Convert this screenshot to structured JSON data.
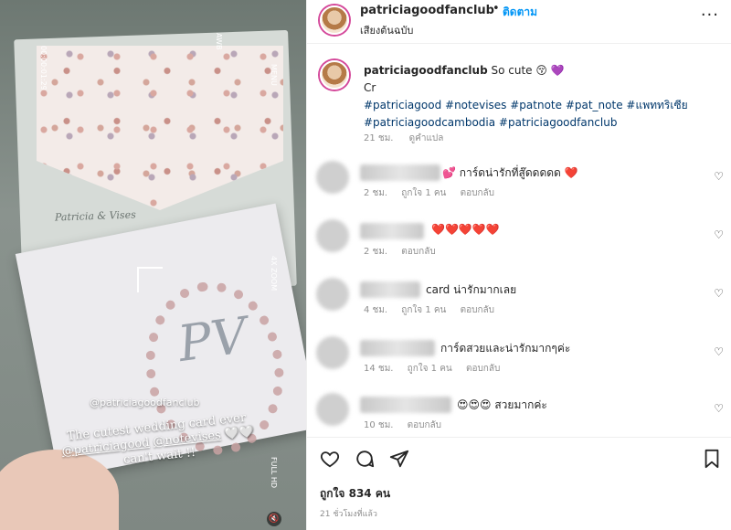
{
  "post": {
    "username": "patriciagoodfanclub",
    "follow_label": "ติดตาม",
    "audio_label": "เสียงต้นฉบับ",
    "more_label": "···"
  },
  "media": {
    "overlay_handle": "@patriciagoodfanclub",
    "overlay_line1": "The cutest wedding card ever",
    "overlay_line2a": "@patriciagood",
    "overlay_line2b": "@notevises",
    "overlay_line3": "can't wait !!",
    "card_script": "Patricia & Vises",
    "monogram": "PV",
    "timecode": "00:00:01:29",
    "awb_label": "AWB",
    "menu_label": "MENU",
    "zoom_label": "4X ZOOM",
    "full_label": "FULL HD"
  },
  "caption": {
    "username": "patriciagoodfanclub",
    "text": "So cute 😚 💜",
    "line2": "Cr",
    "tags_line1": "#patriciagood #notevises #patnote #pat_note #แพททริเซีย",
    "tags_line2": "#patriciagoodcambodia #patriciagoodfanclub",
    "time": "21 ชม.",
    "translate": "ดูคำแปล"
  },
  "comments": [
    {
      "text": "💕 การ์ดน่ารักที่สู๊ดดดดด ❤️",
      "time": "2 ชม.",
      "likes": "ถูกใจ 1 คน",
      "reply": "ตอบกลับ"
    },
    {
      "text": "❤️❤️❤️❤️❤️",
      "time": "2 ชม.",
      "likes": "",
      "reply": "ตอบกลับ"
    },
    {
      "text": "card น่ารักมากเลย",
      "time": "4 ชม.",
      "likes": "ถูกใจ 1 คน",
      "reply": "ตอบกลับ"
    },
    {
      "text": "การ์ดสวยและน่ารักมากๆค่ะ",
      "time": "14 ชม.",
      "likes": "ถูกใจ 1 คน",
      "reply": "ตอบกลับ"
    },
    {
      "text": "😍😍😍 สวยมากค่ะ",
      "time": "10 ชม.",
      "likes": "",
      "reply": "ตอบกลับ"
    }
  ],
  "actions": {
    "likes_count": "ถูกใจ 834 คน",
    "timestamp": "21 ชั่วโมงที่แล้ว"
  },
  "icons": {
    "like": "heart-icon",
    "comment": "comment-icon",
    "share": "share-icon",
    "save": "bookmark-icon"
  },
  "colors": {
    "link": "#0095f6",
    "hashtag": "#00376b",
    "story_ring": "#d4489a"
  }
}
